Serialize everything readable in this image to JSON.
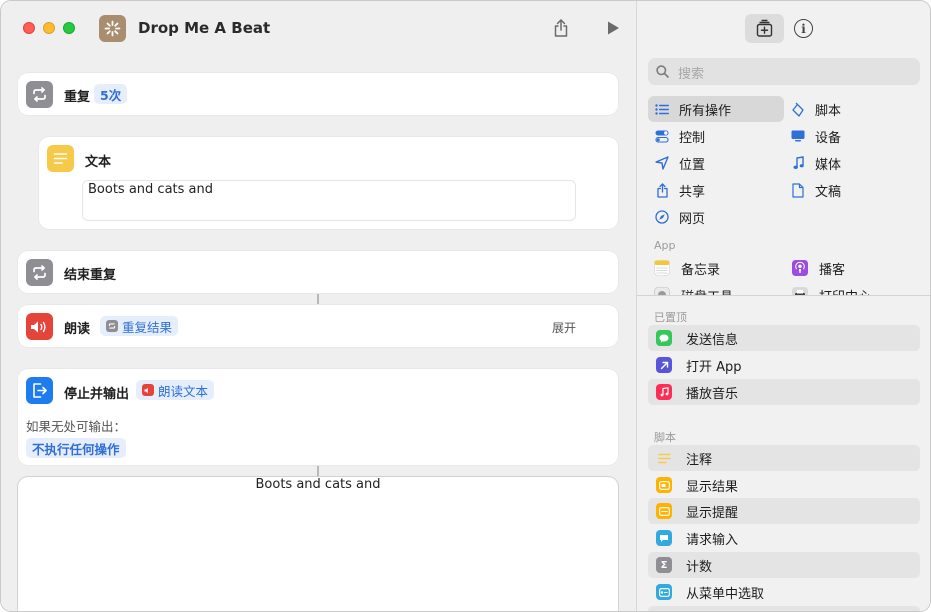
{
  "window": {
    "title": "Drop Me A Beat"
  },
  "editor": {
    "repeat": {
      "label": "重复",
      "count_token": "5次"
    },
    "text_action": {
      "label": "文本",
      "content": "Boots and cats and"
    },
    "end_repeat": {
      "label": "结束重复"
    },
    "speak": {
      "label": "朗读",
      "input_token": "重复结果",
      "expand_label": "展开"
    },
    "stop_output": {
      "label": "停止并输出",
      "input_token": "朗读文本",
      "fallback_label": "如果无处可输出：",
      "fallback_token": "不执行任何操作"
    },
    "result": {
      "text": "Boots and cats and"
    }
  },
  "sidebar": {
    "search_placeholder": "搜索",
    "categories_left": [
      {
        "label": "所有操作",
        "icon": "list-icon"
      },
      {
        "label": "控制",
        "icon": "toggle-icon"
      },
      {
        "label": "位置",
        "icon": "location-arrow-icon"
      },
      {
        "label": "共享",
        "icon": "share-icon"
      },
      {
        "label": "网页",
        "icon": "compass-icon"
      }
    ],
    "categories_right": [
      {
        "label": "脚本",
        "icon": "script-icon"
      },
      {
        "label": "设备",
        "icon": "display-icon"
      },
      {
        "label": "媒体",
        "icon": "music-note-icon"
      },
      {
        "label": "文稿",
        "icon": "document-icon"
      }
    ],
    "app_section_label": "App",
    "apps": [
      {
        "label": "备忘录",
        "icon": "notes-app-icon"
      },
      {
        "label": "播客",
        "icon": "podcasts-app-icon"
      },
      {
        "label": "磁盘工具",
        "icon": "disk-utility-icon"
      },
      {
        "label": "打印中心",
        "icon": "print-center-icon"
      }
    ],
    "pinned_label": "已置顶",
    "pinned": [
      {
        "label": "发送信息",
        "icon": "messages-icon",
        "color": "#34c759"
      },
      {
        "label": "打开 App",
        "icon": "open-app-icon",
        "color": "#5856d6"
      },
      {
        "label": "播放音乐",
        "icon": "music-icon",
        "color": "#ff2d55"
      }
    ],
    "scripting_label": "脚本",
    "scripting": [
      {
        "label": "注释",
        "icon": "comment-lines-icon",
        "color": "#f7c948"
      },
      {
        "label": "显示结果",
        "icon": "show-result-icon",
        "color": "#ffb300"
      },
      {
        "label": "显示提醒",
        "icon": "show-alert-icon",
        "color": "#ffb300"
      },
      {
        "label": "请求输入",
        "icon": "ask-input-icon",
        "color": "#33aadd"
      },
      {
        "label": "计数",
        "icon": "sigma-icon",
        "color": "#8e8e93"
      },
      {
        "label": "从菜单中选取",
        "icon": "choose-menu-icon",
        "color": "#33aadd"
      }
    ]
  }
}
